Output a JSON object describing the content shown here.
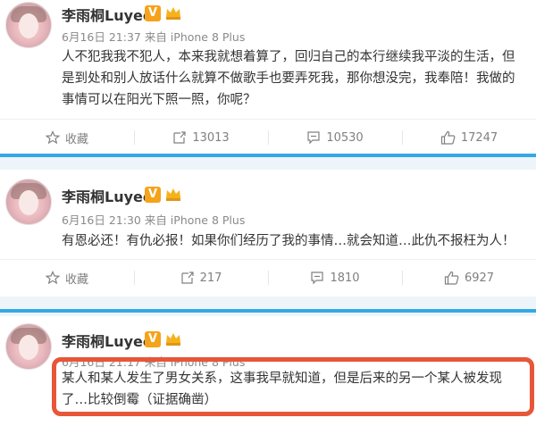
{
  "posts": [
    {
      "author": "李雨桐Luyee",
      "badge": "V",
      "meta": "6月16日 21:37 来自 iPhone 8 Plus",
      "text": "人不犯我我不犯人，本来我就想着算了，回归自己的本行继续我平淡的生活，但是到处和别人放话什么就算不做歌手也要弄死我，那你想没完，我奉陪！我做的事情可以在阳光下照一照，你呢？",
      "actions": {
        "favorite": "收藏",
        "repost": "13013",
        "comment": "10530",
        "like": "17247"
      }
    },
    {
      "author": "李雨桐Luyee",
      "badge": "V",
      "meta": "6月16日 21:30 来自 iPhone 8 Plus",
      "text": "有恩必还！有仇必报！如果你们经历了我的事情…就会知道…此仇不报枉为人！",
      "actions": {
        "favorite": "收藏",
        "repost": "217",
        "comment": "1810",
        "like": "6927"
      }
    },
    {
      "author": "李雨桐Luyee",
      "badge": "V",
      "meta": "6月16日 21:17 来自 iPhone 8 Plus",
      "text": "某人和某人发生了男女关系，这事我早就知道，但是后来的另一个某人被发现了…比较倒霉（证据确凿）"
    }
  ],
  "icons": [
    "star-icon",
    "repost-icon",
    "comment-icon",
    "like-icon",
    "crown-icon"
  ],
  "colors": {
    "highlight": "#e8563a",
    "separator": "#36a8e6",
    "badge": "#f5a31a"
  }
}
